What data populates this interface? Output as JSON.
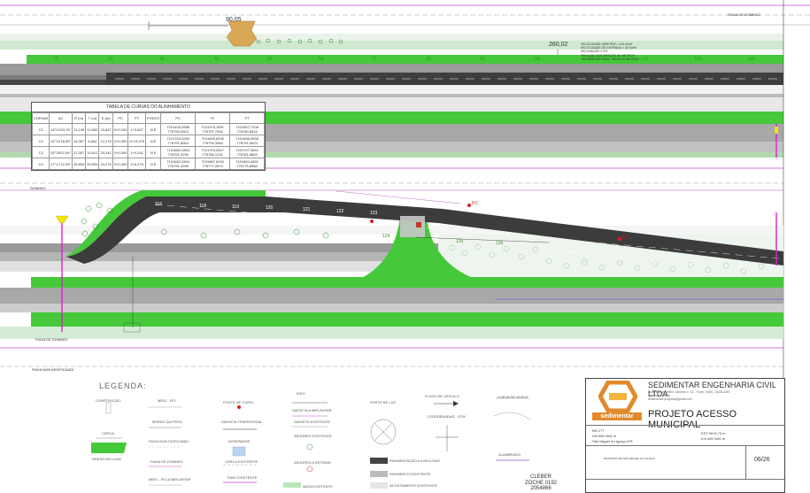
{
  "dimensions": {
    "top": "90,05",
    "right": "260,02"
  },
  "labels": {
    "faixa_dominio_top": "FAIXA DE DOMINIO",
    "faixa_dominio_bottom": "FAIXA DE DOMINIO",
    "faixa_nao_edificante": "FAIXA NON AEDIFICANDI",
    "faixa_dominio_left": "DOMINIO",
    "pc_marker": "PC",
    "notes_block": [
      "VELOCIDADE DIRETRIZ = 110 Km/h",
      "VELOCIDADE DE ENTRADA = 30 Km/h",
      "INCLINAÇÃO 2,0%",
      "FAIXA DE ACELERAÇÃO 80 METROS",
      "TAPER 50 METROS - MESA 25 METROS"
    ]
  },
  "curve_table": {
    "title": "TABELA DE CURVAS DO ALINHAMENTO",
    "headers": [
      "CURVAS",
      "AC",
      "R (m)",
      "T (m)",
      "D (m)",
      "PC",
      "PT",
      "PONTO",
      "PC",
      "PI",
      "PT"
    ],
    "rows": [
      [
        "C1",
        "16°24'24,76\"",
        "74,199",
        "12,552",
        "23,837",
        "0+0,000",
        "1+3,837",
        "N E",
        "7101405,2556 776790,0923",
        "7101379,1591 776797,7916",
        "7101657,7108 776780,5615"
      ],
      [
        "C2",
        "41°32'18,59\"",
        "16,357",
        "6,844",
        "12,276",
        "0+0,000",
        "0+13,276",
        "N E",
        "7101703,3259 776791,8004",
        "7101699,6205 776793,3364",
        "7101696,9558 776791,0023"
      ],
      [
        "C3",
        "42°28'07,84\"",
        "27,307",
        "10,611",
        "20,241",
        "0+0,000",
        "1+0,241",
        "N E",
        "7101682,3454 776791,3290",
        "7101703,2817 776784,1231",
        "7101707,3461 776781,8509"
      ],
      [
        "C4",
        "47°17'12,93\"",
        "35,800",
        "20,594",
        "24,276",
        "0+0,000",
        "2+6,276",
        "N E",
        "7101662,3454 776791,3290",
        "7101667,8194 776777,2674",
        "7101664,4551 776775,8988"
      ]
    ]
  },
  "chainage_top": [
    "15",
    "25",
    "35",
    "45",
    "55",
    "65",
    "75",
    "85",
    "95",
    "105",
    "115",
    "125",
    "135",
    "145"
  ],
  "chainage_road": [
    "116",
    "118",
    "119",
    "120",
    "121",
    "122",
    "123",
    "124",
    "125",
    "126",
    "128",
    "129",
    "130",
    "131",
    "132"
  ],
  "legend": {
    "title": "LEGENDA:",
    "items": [
      "CONSTRUÇÃO",
      "CERCA",
      "DRENO EM LUVA",
      "MEIO - FIO",
      "BORDO DA PISTA",
      "FAIXA NON EDIFICANDI",
      "FAIXA DE DOMINIO",
      "MEIO - FIO A IMPLANTAR",
      "POSTE DE COPEL",
      "SARJETA TRAPEZOIDAL",
      "DISSIPADOR",
      "CERCA EXISTENTE",
      "TUBO EXISTENTE",
      "EIXO",
      "SARJETA A IMPLANTAR",
      "SARJETA EXISTENTE",
      "ARVORES EXISTENTE",
      "ARVORES A RETIRAR",
      "MATA EXISTENTE",
      "POSTE DE LUZ",
      "FLUXO DE VEÍCULO",
      "COORDENADAS - UTM",
      "CURVA DE NIVEIS",
      "PAVIMENTAÇÃO A EXECUTAR",
      "PAVIMENTO EXISTENTE",
      "ACOSTAMENTO EXISTENTE",
      "ALAMBRADO"
    ]
  },
  "title_block": {
    "firm": "SEDIMENTAR ENGENHARIA CIVIL LTDA",
    "address": [
      "Rua Helena Bellini, Ulmeira n. 32 - Fone: (045) - 3028-3087",
      "Toledo - Paraná",
      "sedimentar.projetos@gmail.com"
    ],
    "brand": "sedimentar",
    "project": "PROJETO ACESSO MUNICIPAL",
    "location": [
      "BR-277",
      "KM 681+681 m",
      "São Miguel do Iguaçu-PR."
    ],
    "reference": [
      "EST:39+6,75 m",
      "Km 681+681 m"
    ],
    "client": "MUNICIPIO DE SÃO MIGUEL DO IGUAÇU",
    "engineer": [
      "CLEBER",
      "ZOCHE 0192",
      "2054866"
    ],
    "page": "06/26"
  }
}
